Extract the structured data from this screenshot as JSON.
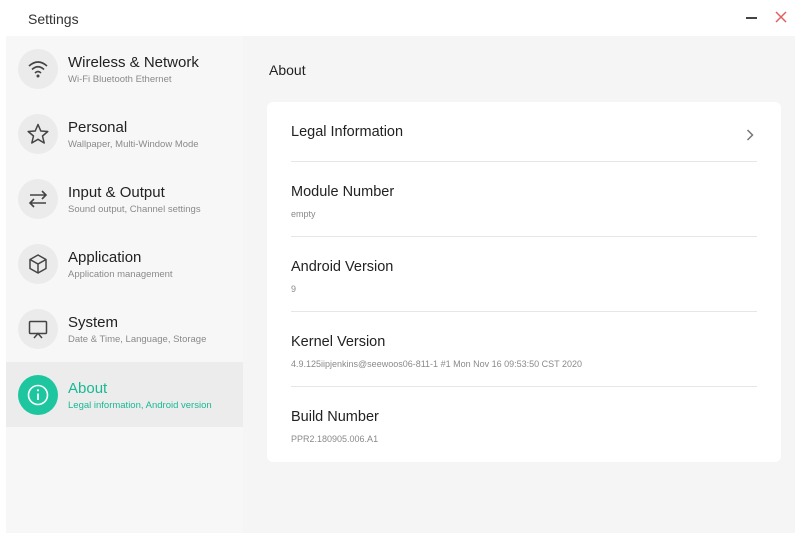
{
  "window": {
    "title": "Settings"
  },
  "sidebar": {
    "items": [
      {
        "label": "Wireless & Network",
        "subtitle": "Wi-Fi Bluetooth Ethernet",
        "icon": "wifi-icon",
        "active": false
      },
      {
        "label": "Personal",
        "subtitle": "Wallpaper, Multi-Window Mode",
        "icon": "star-icon",
        "active": false
      },
      {
        "label": "Input & Output",
        "subtitle": "Sound output, Channel settings",
        "icon": "swap-arrows-icon",
        "active": false
      },
      {
        "label": "Application",
        "subtitle": "Application management",
        "icon": "cube-icon",
        "active": false
      },
      {
        "label": "System",
        "subtitle": "Date & Time, Language, Storage",
        "icon": "monitor-icon",
        "active": false
      },
      {
        "label": "About",
        "subtitle": "Legal information, Android version",
        "icon": "info-icon",
        "active": true
      }
    ]
  },
  "main": {
    "title": "About",
    "rows": {
      "legal": {
        "label": "Legal Information"
      },
      "module": {
        "label": "Module Number",
        "value": "empty"
      },
      "android": {
        "label": "Android Version",
        "value": "9"
      },
      "kernel": {
        "label": "Kernel Version",
        "value": "4.9.125iipjenkins@seewoos06-811-1 #1  Mon Nov 16 09:53:50 CST 2020"
      },
      "build": {
        "label": "Build Number",
        "value": "PPR2.180905.006.A1"
      }
    }
  },
  "colors": {
    "accent": "#1ec6a0",
    "close": "#e06060"
  }
}
